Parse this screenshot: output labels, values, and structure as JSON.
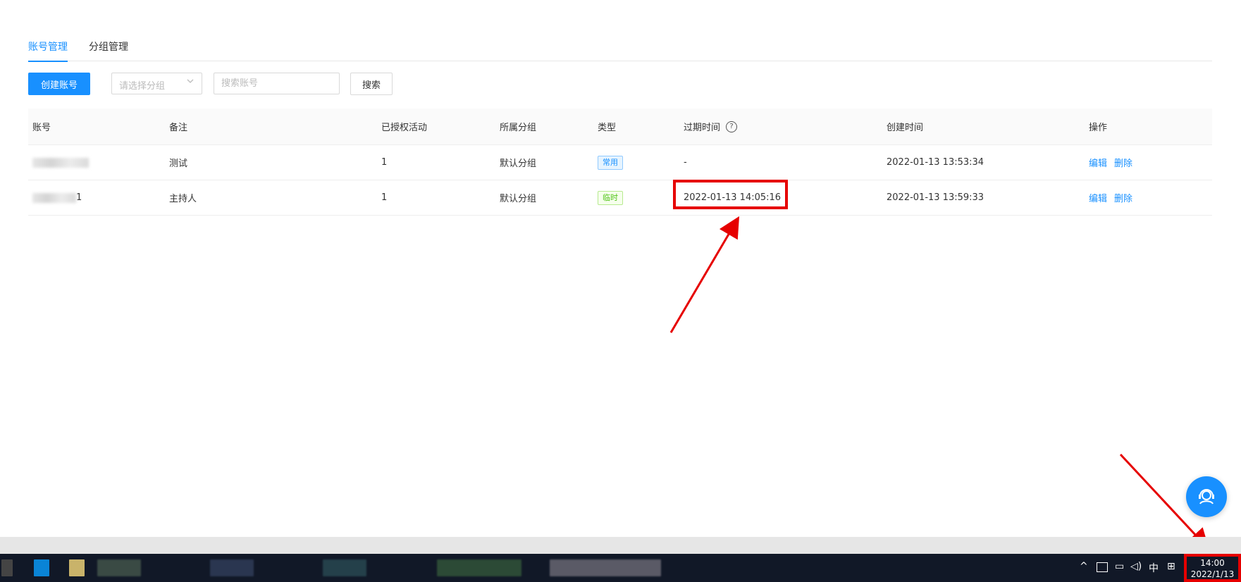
{
  "tabs": [
    {
      "label": "账号管理",
      "active": true
    },
    {
      "label": "分组管理",
      "active": false
    }
  ],
  "toolbar": {
    "create_label": "创建账号",
    "group_placeholder": "请选择分组",
    "search_placeholder": "搜索账号",
    "search_label": "搜索"
  },
  "table": {
    "headers": [
      "账号",
      "备注",
      "已授权活动",
      "所属分组",
      "类型",
      "过期时间",
      "创建时间",
      "操作"
    ],
    "rows": [
      {
        "account_suffix": "",
        "note": "测试",
        "authorized": "1",
        "group": "默认分组",
        "type": "常用",
        "expire": "-",
        "created": "2022-01-13 13:53:34",
        "edit": "编辑",
        "delete": "删除"
      },
      {
        "account_suffix": "1",
        "note": "主持人",
        "authorized": "1",
        "group": "默认分组",
        "type": "临时",
        "expire": "2022-01-13 14:05:16",
        "created": "2022-01-13 13:59:33",
        "edit": "编辑",
        "delete": "删除"
      }
    ]
  },
  "colors": {
    "accent": "#1890ff",
    "highlight": "#e60000",
    "tag_blue": "#1890ff",
    "tag_green": "#52c41a",
    "taskbar": "#111827"
  },
  "taskbar": {
    "ime": "中",
    "time": "14:00",
    "date": "2022/1/13"
  }
}
